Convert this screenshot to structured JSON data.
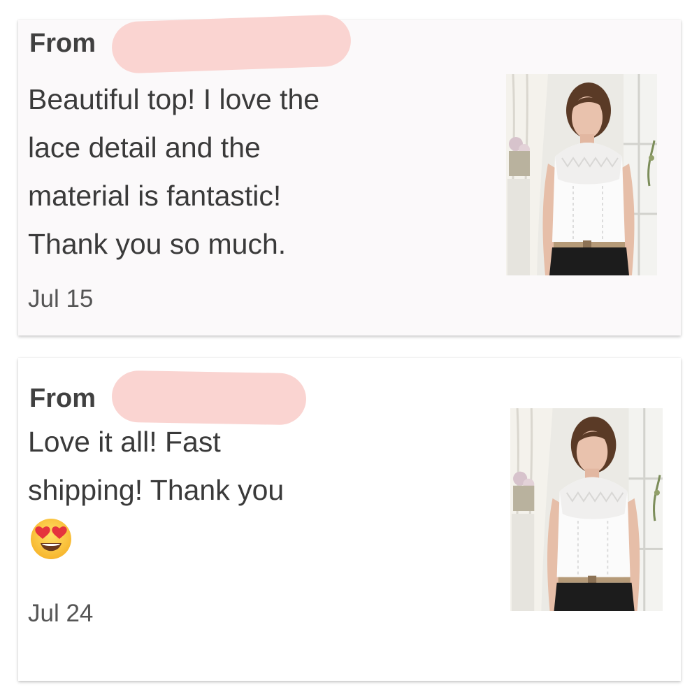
{
  "reviews": [
    {
      "from_label": "From",
      "text_lines": [
        "Beautiful top! I love the",
        "lace detail and the",
        "material is fantastic!",
        "Thank you so much."
      ],
      "date": "Jul 15"
    },
    {
      "from_label": "From",
      "text_lines": [
        "Love it all! Fast",
        "shipping! Thank you"
      ],
      "emoji": "heart-eyes-emoji",
      "date": "Jul 24"
    }
  ],
  "colors": {
    "card1_bg": "#fbf9fa",
    "card2_bg": "#ffffff",
    "redaction": "#fad4d1",
    "text": "#3a3a3a"
  }
}
